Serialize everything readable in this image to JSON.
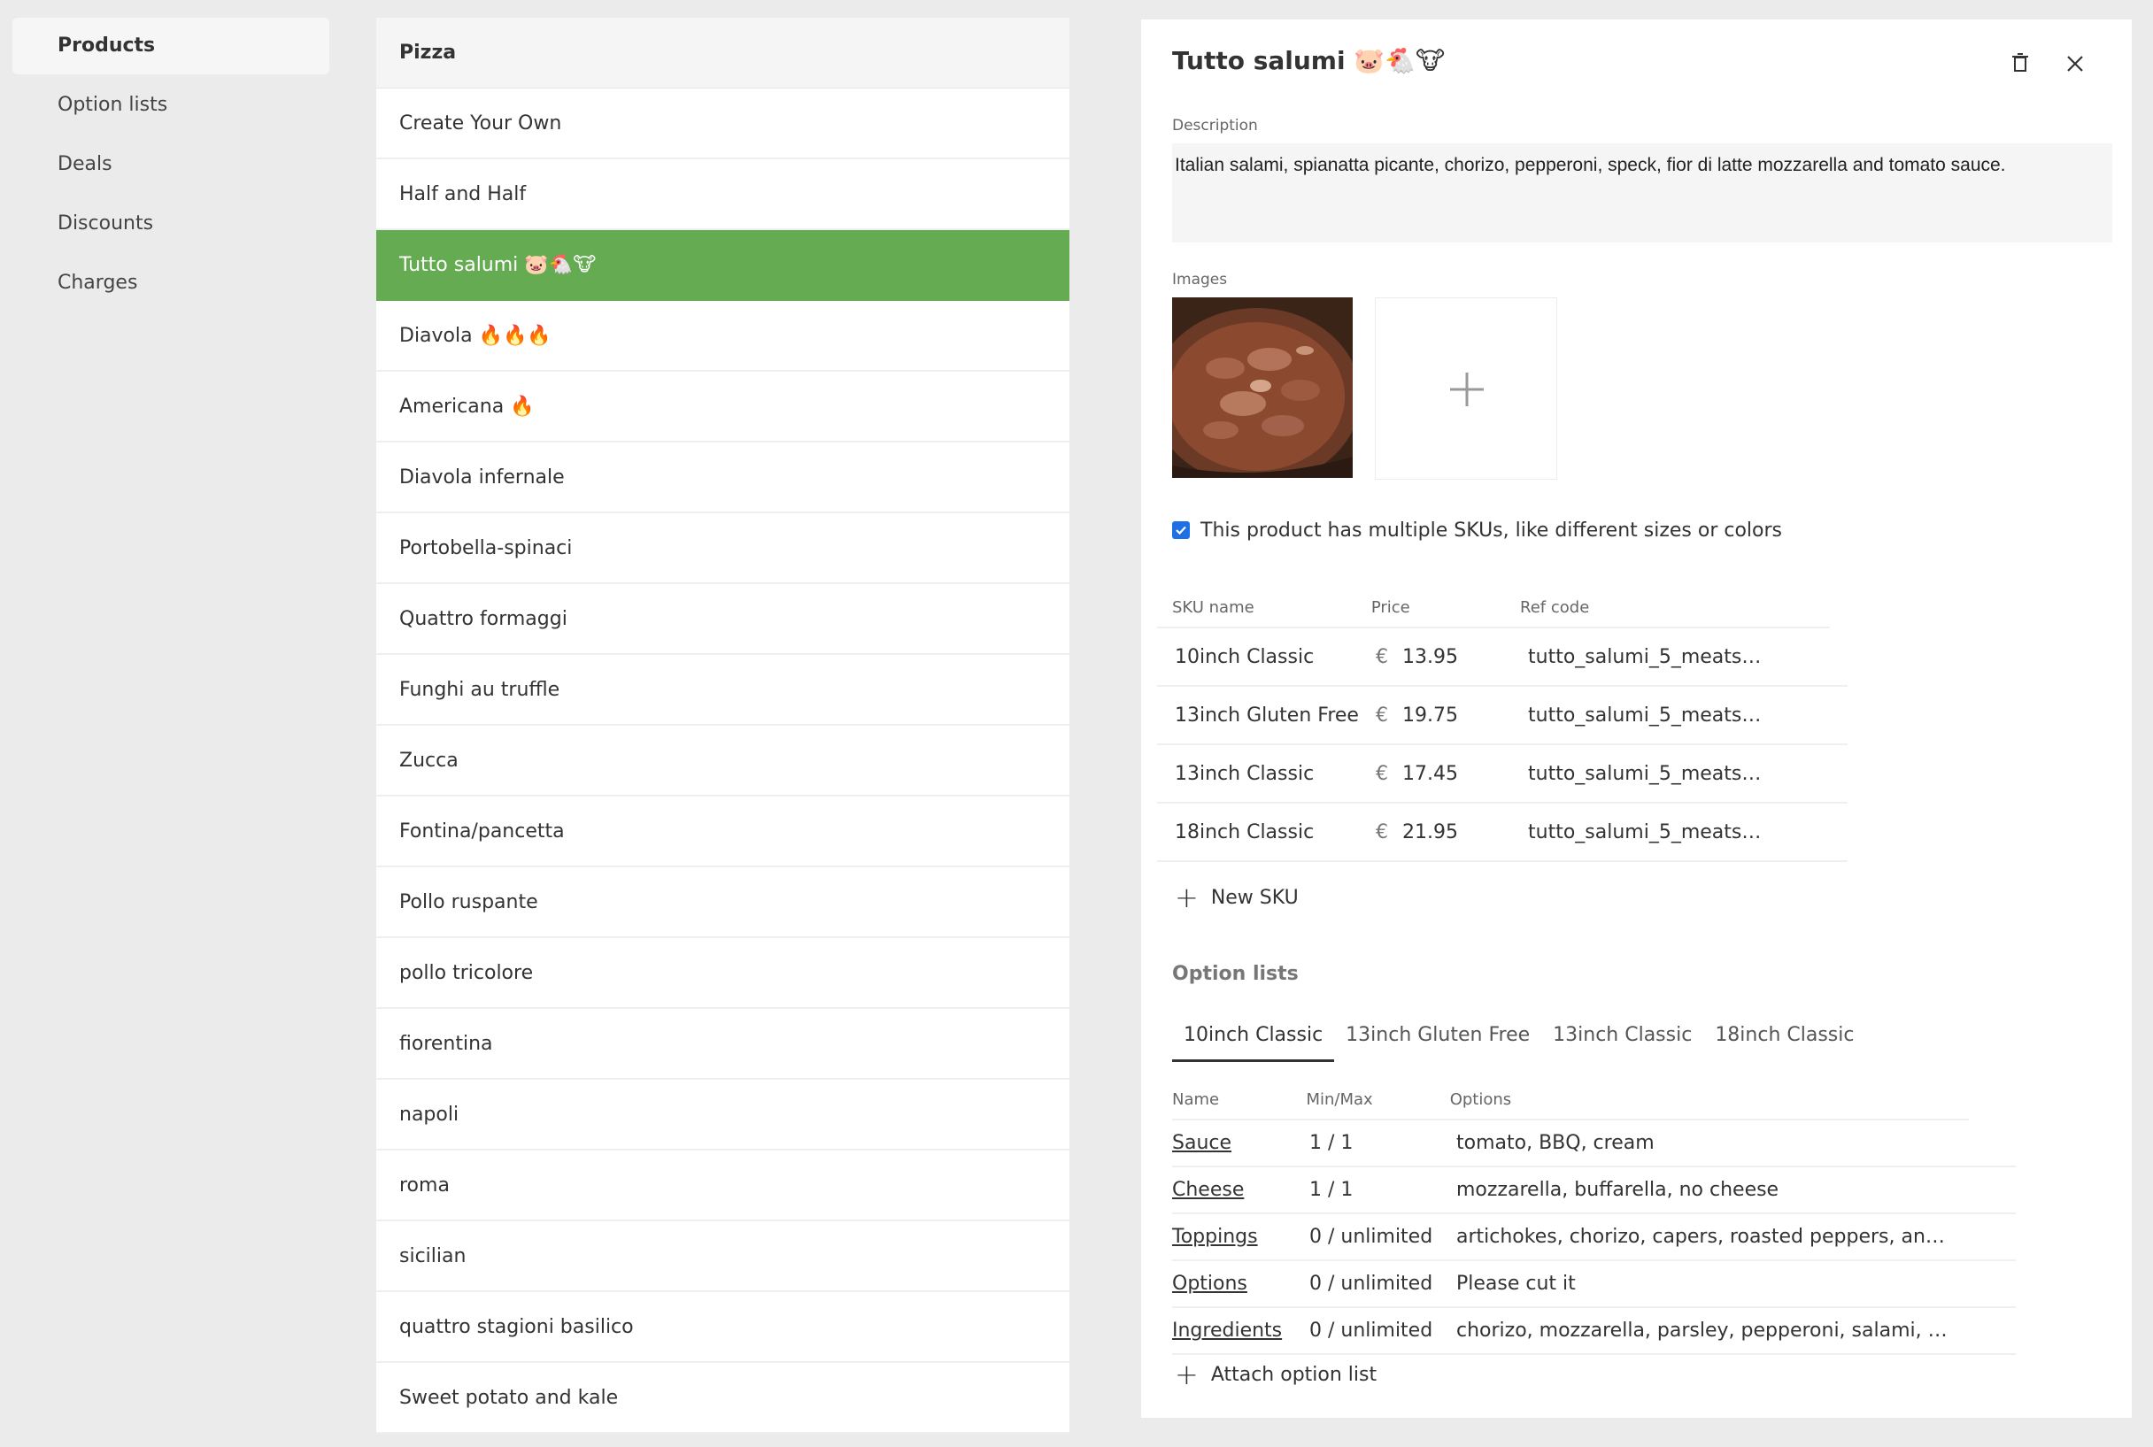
{
  "sidebar": {
    "items": [
      {
        "label": "Products"
      },
      {
        "label": "Option lists"
      },
      {
        "label": "Deals"
      },
      {
        "label": "Discounts"
      },
      {
        "label": "Charges"
      }
    ]
  },
  "product_list": {
    "category": "Pizza",
    "items": [
      {
        "label": "Create Your Own"
      },
      {
        "label": "Half and Half"
      },
      {
        "label": "Tutto salumi 🐷🐔🐮"
      },
      {
        "label": "Diavola 🔥🔥🔥"
      },
      {
        "label": "Americana 🔥"
      },
      {
        "label": "Diavola infernale"
      },
      {
        "label": "Portobella-spinaci"
      },
      {
        "label": "Quattro formaggi"
      },
      {
        "label": "Funghi au truffle"
      },
      {
        "label": "Zucca"
      },
      {
        "label": "Fontina/pancetta"
      },
      {
        "label": "Pollo ruspante"
      },
      {
        "label": "pollo tricolore"
      },
      {
        "label": "fiorentina"
      },
      {
        "label": "napoli"
      },
      {
        "label": "roma"
      },
      {
        "label": "sicilian"
      },
      {
        "label": "quattro stagioni basilico"
      },
      {
        "label": "Sweet potato and kale"
      }
    ],
    "selected_color": "#64ab51"
  },
  "detail": {
    "title": "Tutto salumi 🐷🐔🐮",
    "description_label": "Description",
    "description": "Italian salami, spianatta picante, chorizo, pepperoni, speck, fior di latte mozzarella and tomato sauce.",
    "images_label": "Images",
    "multi_sku_label": "This product has multiple SKUs, like different sizes or colors",
    "sku_headers": {
      "name": "SKU name",
      "price": "Price",
      "ref": "Ref code"
    },
    "skus": [
      {
        "name": "10inch Classic",
        "currency": "€",
        "price": "13.95",
        "ref": "tutto_salumi_5_meats…"
      },
      {
        "name": "13inch Gluten Free",
        "currency": "€",
        "price": "19.75",
        "ref": "tutto_salumi_5_meats…"
      },
      {
        "name": "13inch Classic",
        "currency": "€",
        "price": "17.45",
        "ref": "tutto_salumi_5_meats…"
      },
      {
        "name": "18inch Classic",
        "currency": "€",
        "price": "21.95",
        "ref": "tutto_salumi_5_meats…"
      }
    ],
    "new_sku_label": "New SKU",
    "option_lists_title": "Option lists",
    "tabs": [
      {
        "label": "10inch Classic"
      },
      {
        "label": "13inch Gluten Free"
      },
      {
        "label": "13inch Classic"
      },
      {
        "label": "18inch Classic"
      }
    ],
    "option_headers": {
      "name": "Name",
      "minmax": "Min/Max",
      "options": "Options"
    },
    "options": [
      {
        "name": "Sauce",
        "minmax": "1 / 1",
        "options": "tomato, BBQ, cream"
      },
      {
        "name": "Cheese",
        "minmax": "1 / 1",
        "options": "mozzarella, buffarella, no cheese"
      },
      {
        "name": "Toppings",
        "minmax": "0 / unlimited",
        "options": "artichokes, chorizo, capers, roasted peppers, an…"
      },
      {
        "name": "Options",
        "minmax": "0 / unlimited",
        "options": "Please cut it"
      },
      {
        "name": "Ingredients",
        "minmax": "0 / unlimited",
        "options": "chorizo, mozzarella, parsley, pepperoni, salami, …"
      }
    ],
    "attach_label": "Attach option list"
  },
  "icons": {
    "trash": "trash-icon",
    "close": "close-icon",
    "plus": "plus-icon",
    "check": "check-icon"
  }
}
